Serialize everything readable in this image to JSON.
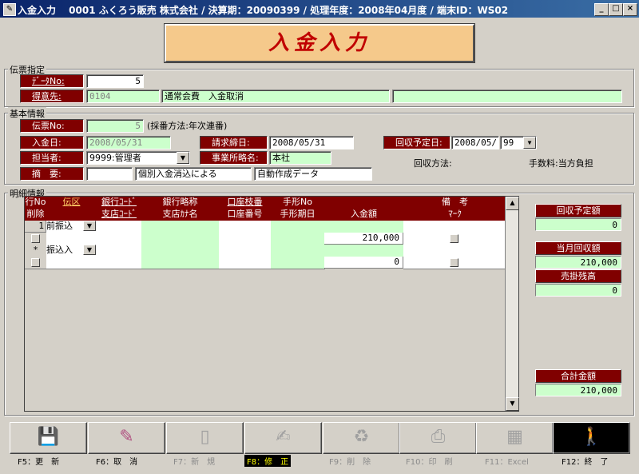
{
  "window": {
    "title": "入金入力　 0001 ふくろう販売 株式会社 / 決算期：20090399 / 処理年度：2008年04月度 / 端末ID：WS02",
    "min_btn": "_",
    "max_btn": "□",
    "close_btn": "×"
  },
  "banner": {
    "text": "入金入力"
  },
  "denpyo_shitei": {
    "group_label": "伝票指定",
    "data_no_label": "ﾃﾞｰﾀNo:",
    "data_no_value": "5",
    "tokuisaki_label": "得意先:",
    "tokuisaki_code": "0104",
    "tokuisaki_name": "通常会費　入金取消",
    "tokuisaki_extra": ""
  },
  "kihon": {
    "group_label": "基本情報",
    "denpyo_no_label": "伝票No:",
    "denpyo_no_value": "5",
    "saiban_note": "(採番方法:年次連番)",
    "nyukin_bi_label": "入金日:",
    "nyukin_bi_value": "2008/05/31",
    "seikyu_label": "請求締日:",
    "seikyu_value": "2008/05/31",
    "kaishu_yotei_label": "回収予定日:",
    "kaishu_yotei_value": "2008/05/",
    "kaishu_yotei_day": "99",
    "tanto_label": "担当者:",
    "tanto_value": "9999:管理者",
    "jigyosho_label": "事業所略名:",
    "jigyosho_value": "本社",
    "tekiyo_label": "摘　要:",
    "tekiyo_code": "",
    "tekiyo_text1": "個別入金消込による",
    "tekiyo_text2": "自動作成データ",
    "kaishu_hoho": "回収方法:",
    "tesuryo": "手数料:当方負担"
  },
  "meisai": {
    "group_label": "明細情報",
    "headers_top": [
      "行No",
      "伝区",
      "銀行ｺｰﾄﾞ",
      "銀行略称",
      "口座枝番",
      "手形No",
      "",
      "備　考"
    ],
    "headers_bottom": [
      "削除",
      "",
      "支店ｺｰﾄﾞ",
      "支店ｶﾅ名",
      "口座番号",
      "手形期日",
      "入金額",
      "ﾏｰｸ"
    ],
    "rows": [
      {
        "no": "1",
        "denku": "前振込",
        "amount": "210,000"
      },
      {
        "no": "*",
        "denku": "振込入",
        "amount": "0"
      }
    ]
  },
  "summary": {
    "kaishu_yotei_label": "回収予定額",
    "kaishu_yotei_value": "0",
    "togetsu_label": "当月回収額",
    "togetsu_value": "210,000",
    "urikake_label": "売掛残高",
    "urikake_value": "0",
    "gokei_label": "合計金額",
    "gokei_value": "210,000"
  },
  "toolbar": {
    "keys": [
      {
        "label": "F5：更　新",
        "icon": "floppy-disk-icon",
        "glyph": "💾",
        "enabled": true
      },
      {
        "label": "F6：取　消",
        "icon": "eraser-icon",
        "glyph": "✎",
        "enabled": true
      },
      {
        "label": "F7：新　規",
        "icon": "new-document-icon",
        "glyph": "▯",
        "enabled": false
      },
      {
        "label": "F8：修　正",
        "icon": "edit-document-icon",
        "glyph": "✍",
        "enabled": false,
        "highlight": true
      },
      {
        "label": "F9：削　除",
        "icon": "recycle-icon",
        "glyph": "♻",
        "enabled": false
      },
      {
        "label": "F10：印　刷",
        "icon": "printer-icon",
        "glyph": "⎙",
        "enabled": false
      },
      {
        "label": "F11：Excel",
        "icon": "excel-icon",
        "glyph": "▦",
        "enabled": false
      },
      {
        "label": "F12：終　了",
        "icon": "exit-door-icon",
        "glyph": "🚶",
        "enabled": true
      }
    ]
  },
  "colors": {
    "label_bg": "#800000",
    "field_green": "#ccffcc",
    "banner_bg": "#f5c98b",
    "banner_text": "#c00000"
  }
}
